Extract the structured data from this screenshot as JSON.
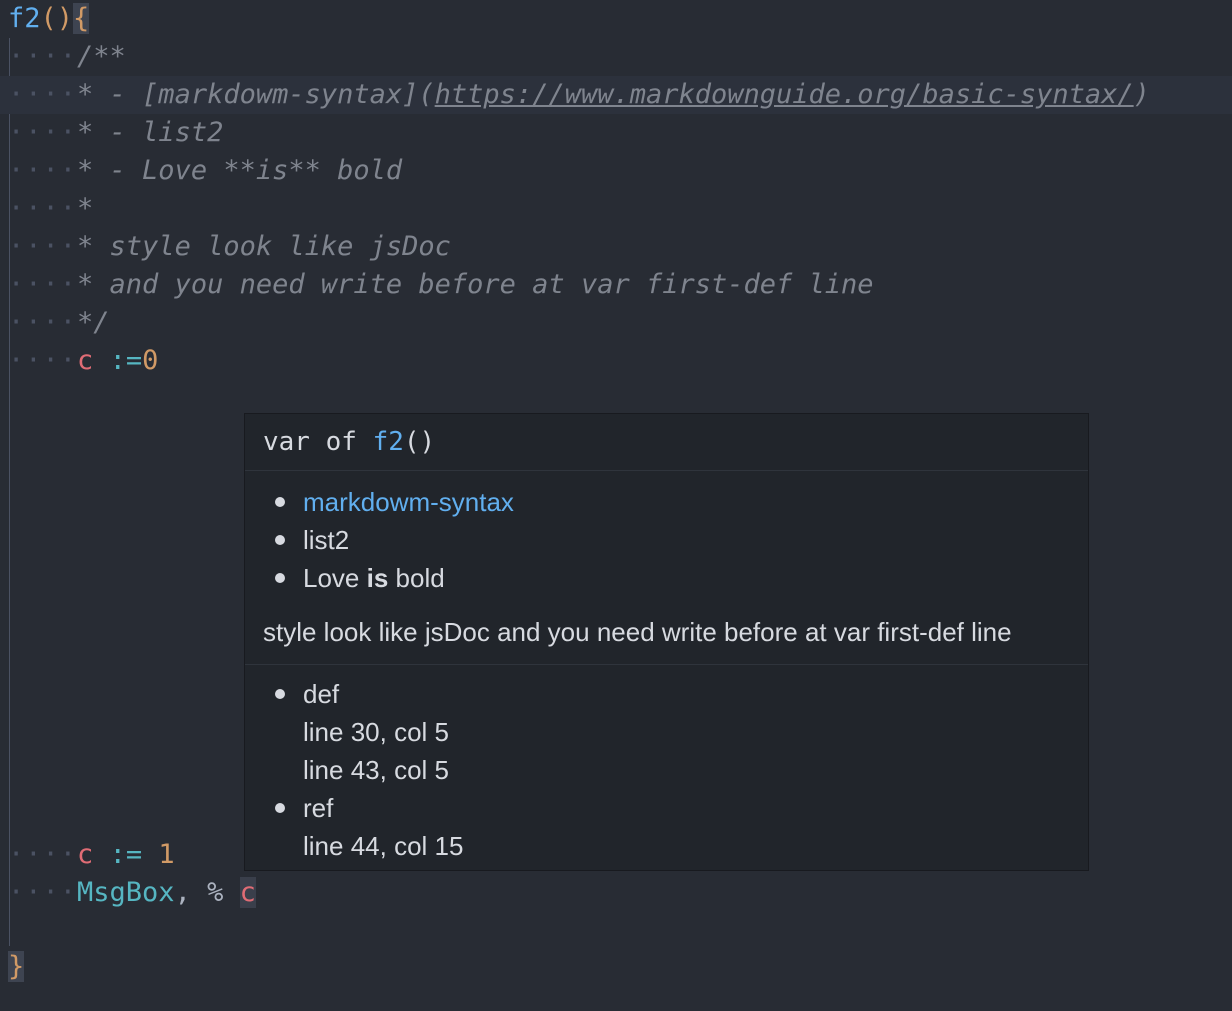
{
  "editor": {
    "function_name": "f2",
    "function_parens": "()",
    "open_brace": "{",
    "close_brace": "}",
    "comment_lines": [
      "/**",
      "* - [markdowm-syntax](",
      "https://www.markdownguide.org/basic-syntax/",
      ")",
      "* - list2",
      "* - Love **is** bold",
      "*",
      "* style look like jsDoc",
      "* and you need write before at var first-def line",
      "*/"
    ],
    "line_c0": {
      "var": "c",
      "op": ":=",
      "value": "0"
    },
    "line_c1": {
      "var": "c",
      "op": ":=",
      "value": "1"
    },
    "line_msgbox": {
      "func": "MsgBox",
      "comma": ",",
      "percent": "%",
      "var": "c"
    },
    "indent_dots": "····"
  },
  "hover": {
    "signature_prefix": "var of",
    "signature_fn": "f2",
    "signature_parens": "()",
    "doc_items": {
      "link_text": "markdowm-syntax",
      "item2": "list2",
      "item3_pre": "Love",
      "item3_bold": "is",
      "item3_post": "bold"
    },
    "doc_paragraph": "style look like jsDoc and you need write before at var first-def line",
    "refs": {
      "def_label": "def",
      "def_locations": [
        "line 30, col 5",
        "line 43, col 5"
      ],
      "ref_label": "ref",
      "ref_locations": [
        "line 44, col 15"
      ]
    }
  },
  "colors": {
    "background": "#282c34",
    "function": "#61afef",
    "variable": "#e06c75",
    "operator": "#56b6c2",
    "number": "#d19a66",
    "comment": "#7f848e",
    "popup_bg": "#21252b"
  }
}
